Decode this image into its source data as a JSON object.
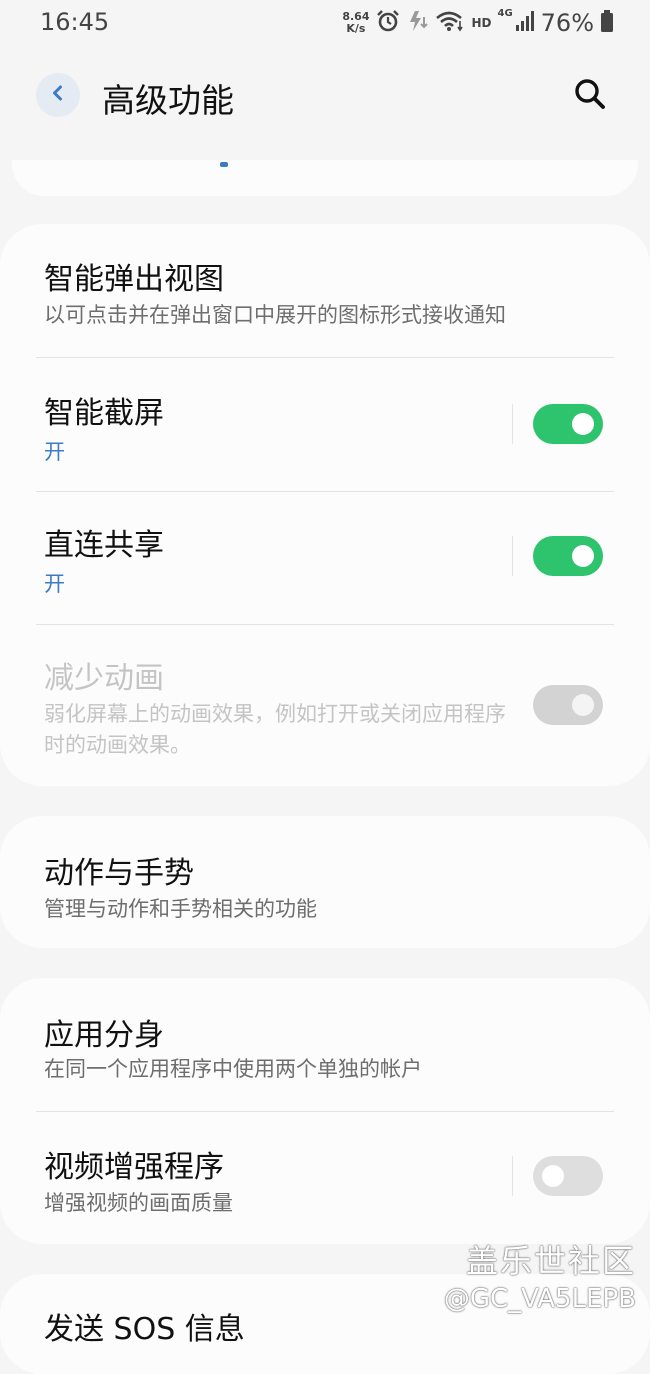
{
  "status_bar": {
    "time": "16:45",
    "net_speed_value": "8.64",
    "net_speed_unit": "K/s",
    "hd_label": "HD",
    "network_type": "4G",
    "battery_percent": "76%"
  },
  "header": {
    "title": "高级功能"
  },
  "card1": {
    "items": [
      {
        "title": "智能弹出视图",
        "subtitle": "以可点击并在弹出窗口中展开的图标形式接收通知"
      },
      {
        "title": "智能截屏",
        "status": "开",
        "toggle_on": true
      },
      {
        "title": "直连共享",
        "status": "开",
        "toggle_on": true
      },
      {
        "title": "减少动画",
        "subtitle": "弱化屏幕上的动画效果，例如打开或关闭应用程序时的动画效果。",
        "toggle_on": false,
        "disabled": true
      }
    ]
  },
  "card2": {
    "items": [
      {
        "title": "动作与手势",
        "subtitle": "管理与动作和手势相关的功能"
      }
    ]
  },
  "card3": {
    "items": [
      {
        "title": "应用分身",
        "subtitle": "在同一个应用程序中使用两个单独的帐户"
      },
      {
        "title": "视频增强程序",
        "subtitle": "增强视频的画面质量",
        "toggle_on": false
      }
    ]
  },
  "card4": {
    "items": [
      {
        "title": "发送 SOS 信息"
      }
    ]
  },
  "watermark": {
    "brand": "盖乐世社区",
    "user": "@GC_VA5LEPB"
  },
  "colors": {
    "accent_blue": "#3d7bc4",
    "toggle_green": "#2ec36d",
    "background": "#f5f5f5",
    "card": "#fcfcfc"
  }
}
